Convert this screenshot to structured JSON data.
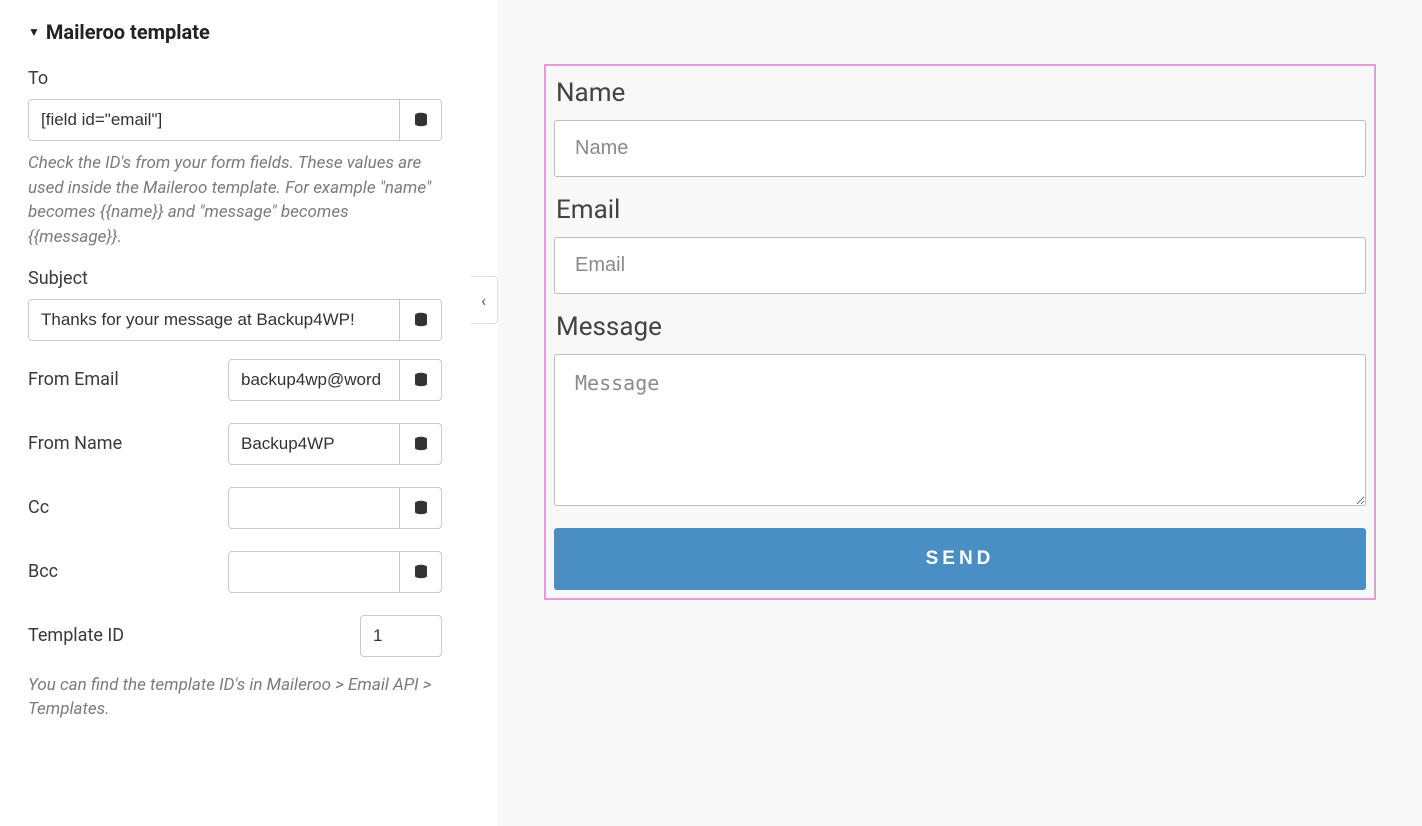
{
  "sidebar": {
    "panel_title": "Maileroo template",
    "to": {
      "label": "To",
      "value": "[field id=\"email\"]",
      "help": "Check the ID's from your form fields. These values are used inside the Maileroo template. For example \"name\" becomes {{name}} and \"message\" becomes {{message}}."
    },
    "subject": {
      "label": "Subject",
      "value": "Thanks for your message at Backup4WP!"
    },
    "from_email": {
      "label": "From Email",
      "value": "backup4wp@word"
    },
    "from_name": {
      "label": "From Name",
      "value": "Backup4WP"
    },
    "cc": {
      "label": "Cc",
      "value": ""
    },
    "bcc": {
      "label": "Bcc",
      "value": ""
    },
    "template_id": {
      "label": "Template ID",
      "value": "1",
      "help": "You can find the template ID's in Maileroo > Email API > Templates."
    }
  },
  "preview": {
    "fields": {
      "name": {
        "label": "Name",
        "placeholder": "Name"
      },
      "email": {
        "label": "Email",
        "placeholder": "Email"
      },
      "message": {
        "label": "Message",
        "placeholder": "Message"
      }
    },
    "submit_label": "SEND"
  }
}
